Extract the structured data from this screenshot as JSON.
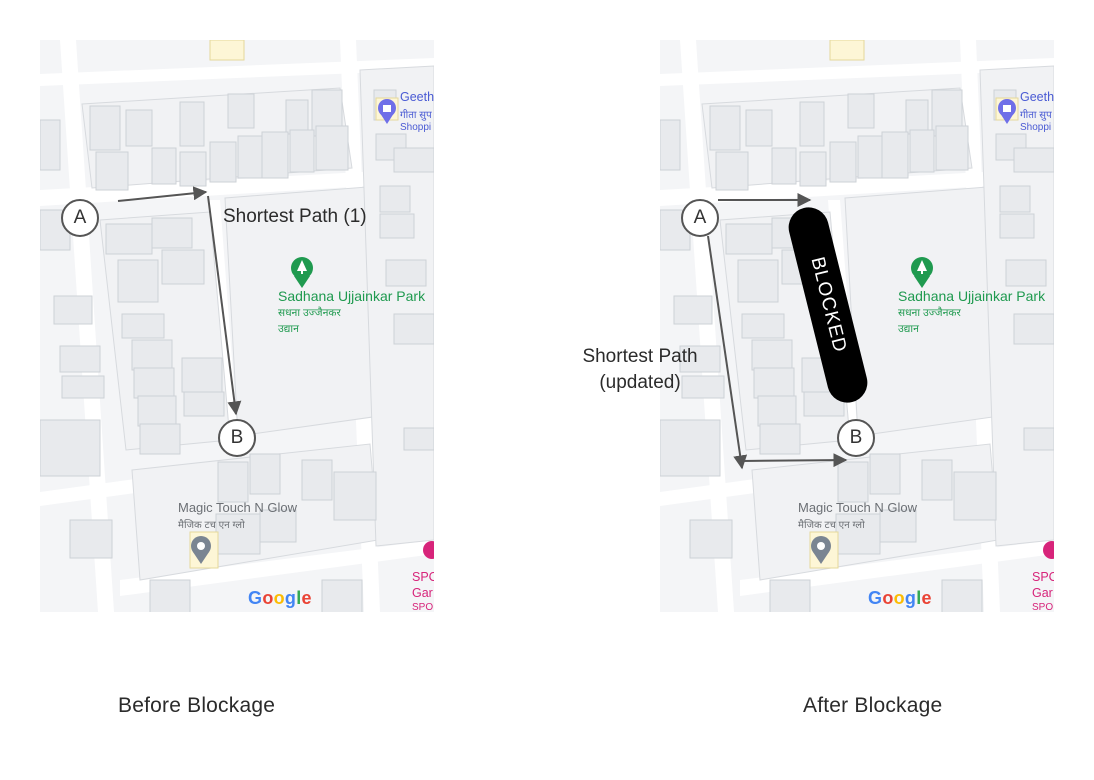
{
  "colors": {
    "map_bg": "#f4f5f7",
    "building": "#e8eaed",
    "building_stroke": "#cdd1d6",
    "road": "#ffffff",
    "arrow": "#555555",
    "park_green": "#1f9a4f",
    "blocked": "#000000"
  },
  "left_panel": {
    "caption": "Before Blockage",
    "path_label": "Shortest Path (1)",
    "node_a": "A",
    "node_b": "B"
  },
  "right_panel": {
    "caption": "After Blockage",
    "path_label_line1": "Shortest Path",
    "path_label_line2": "(updated)",
    "blocked_label": "BLOCKED",
    "node_a": "A",
    "node_b": "B"
  },
  "map_labels": {
    "park_name": "Sadhana Ujjainkar Park",
    "park_sub1": "सधना उज्जैनकर",
    "park_sub2": "उद्यान",
    "shop_name": "Magic Touch N Glow",
    "shop_sub": "मैजिक टच एन ग्लो",
    "geeth": "Geeth",
    "geeth_sub": "गीता सुप",
    "geeth_sub2": "Shoppi",
    "spo": "SPC",
    "spo2": "Gar",
    "spo3": "SPO",
    "google": "Google"
  },
  "icons": {
    "park": "park-pin-icon",
    "shop": "location-pin-icon",
    "geeth": "shopping-bag-pin-icon",
    "spo": "pink-pin-icon"
  }
}
